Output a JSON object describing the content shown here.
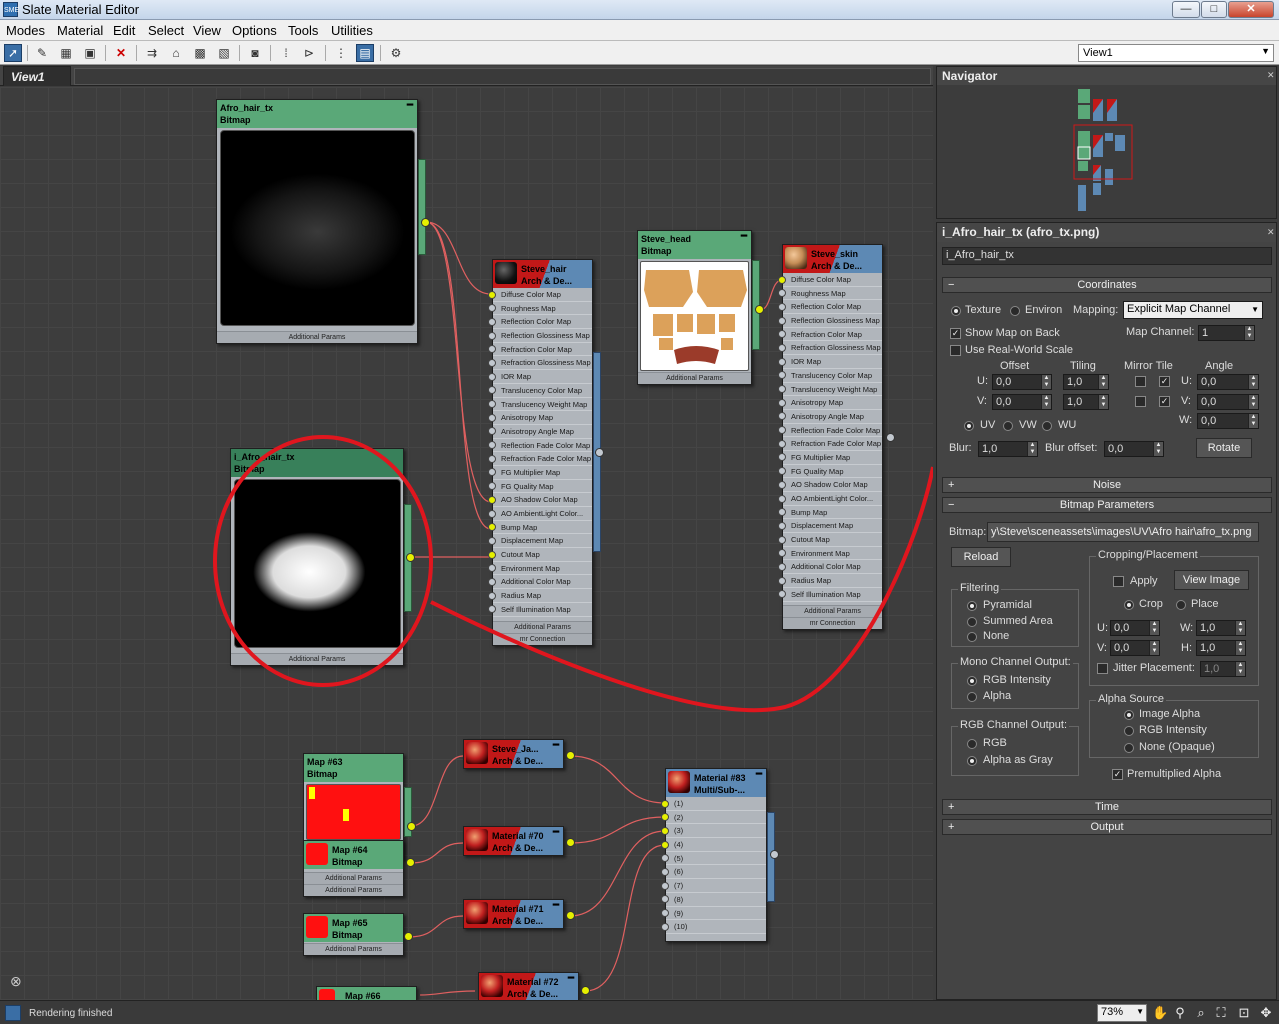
{
  "window": {
    "title": "Slate Material Editor",
    "app_icon_text": "SME",
    "buttons": [
      "—",
      "□",
      "✕"
    ]
  },
  "menu": [
    "Modes",
    "Material",
    "Edit",
    "Select",
    "View",
    "Options",
    "Tools",
    "Utilities"
  ],
  "toolbar": {
    "view_select": "View1"
  },
  "tabs": {
    "active": "View1"
  },
  "nodes": {
    "afro_hair_tx": {
      "name": "Afro_hair_tx",
      "type": "Bitmap",
      "footer": "Additional Params"
    },
    "i_afro_hair_tx": {
      "name": "i_Afro_hair_tx",
      "type": "Bitmap",
      "footer": "Additional Params"
    },
    "steve_head": {
      "name": "Steve_head",
      "type": "Bitmap",
      "footer": "Additional Params"
    },
    "steve_hair": {
      "name": "Steve_hair",
      "type": "Arch & De...",
      "footer1": "Additional Params",
      "footer2": "mr Connection",
      "slots": [
        "Diffuse Color Map",
        "Roughness Map",
        "Reflection Color Map",
        "Reflection Glossiness Map",
        "Refraction Color Map",
        "Refraction Glossiness Map",
        "IOR Map",
        "Translucency Color Map",
        "Translucency Weight Map",
        "Anisotropy Map",
        "Anisotropy Angle Map",
        "Reflection Fade Color Map",
        "Refraction Fade Color Map",
        "FG Multiplier Map",
        "FG Quality Map",
        "AO Shadow Color Map",
        "AO AmbientLight Color...",
        "Bump Map",
        "Displacement Map",
        "Cutout Map",
        "Environment Map",
        "Additional Color Map",
        "Radius Map",
        "Self Illumination Map"
      ]
    },
    "steve_skin": {
      "name": "Steve_skin",
      "type": "Arch & De...",
      "footer1": "Additional Params",
      "footer2": "mr Connection",
      "slots": [
        "Diffuse Color Map",
        "Roughness Map",
        "Reflection Color Map",
        "Reflection Glossiness Map",
        "Refraction Color Map",
        "Refraction Glossiness Map",
        "IOR Map",
        "Translucency Color Map",
        "Translucency Weight Map",
        "Anisotropy Map",
        "Anisotropy Angle Map",
        "Reflection Fade Color Map",
        "Refraction Fade Color Map",
        "FG Multiplier Map",
        "FG Quality Map",
        "AO Shadow Color Map",
        "AO AmbientLight Color...",
        "Bump Map",
        "Displacement Map",
        "Cutout Map",
        "Environment Map",
        "Additional Color Map",
        "Radius Map",
        "Self Illumination Map"
      ]
    },
    "map63": {
      "name": "Map #63",
      "type": "Bitmap",
      "footer": "Additional Params"
    },
    "map64": {
      "name": "Map #64",
      "type": "Bitmap",
      "footer": "Additional Params"
    },
    "map65": {
      "name": "Map #65",
      "type": "Bitmap",
      "footer": "Additional Params"
    },
    "map66": {
      "name": "Map #66"
    },
    "steve_ja": {
      "name": "Steve_Ja...",
      "type": "Arch & De..."
    },
    "mat70": {
      "name": "Material #70",
      "type": "Arch & De..."
    },
    "mat71": {
      "name": "Material #71",
      "type": "Arch & De..."
    },
    "mat72": {
      "name": "Material #72",
      "type": "Arch & De..."
    },
    "mat83": {
      "name": "Material #83",
      "type": "Multi/Sub-...",
      "slots": [
        "(1)",
        "(2)",
        "(3)",
        "(4)",
        "(5)",
        "(6)",
        "(7)",
        "(8)",
        "(9)",
        "(10)"
      ]
    }
  },
  "navigator": {
    "title": "Navigator"
  },
  "properties": {
    "title": "i_Afro_hair_tx (afro_tx.png)",
    "name_field": "i_Afro_hair_tx",
    "coordinates": {
      "rollout": "Coordinates",
      "texture": "Texture",
      "environ": "Environ",
      "mapping_label": "Mapping:",
      "mapping_value": "Explicit Map Channel",
      "show_map_on_back": "Show Map on Back",
      "map_channel_label": "Map Channel:",
      "map_channel_value": "1",
      "use_real_world_scale": "Use Real-World Scale",
      "offset": "Offset",
      "tiling": "Tiling",
      "mirror_tile": "Mirror Tile",
      "angle": "Angle",
      "u_label": "U:",
      "v_label": "V:",
      "w_label": "W:",
      "u_offset": "0,0",
      "v_offset": "0,0",
      "u_tiling": "1,0",
      "v_tiling": "1,0",
      "u_angle": "0,0",
      "v_angle": "0,0",
      "w_angle": "0,0",
      "uv": "UV",
      "vw": "VW",
      "wu": "WU",
      "blur_label": "Blur:",
      "blur_value": "1,0",
      "blur_offset_label": "Blur offset:",
      "blur_offset_value": "0,0",
      "rotate": "Rotate"
    },
    "noise": "Noise",
    "bitmap_params": {
      "rollout": "Bitmap Parameters",
      "bitmap_label": "Bitmap:",
      "bitmap_path": "y\\Steve\\sceneassets\\images\\UV\\Afro hair\\afro_tx.png",
      "reload": "Reload",
      "cropping_placement": "Cropping/Placement",
      "apply": "Apply",
      "view_image": "View Image",
      "crop": "Crop",
      "place": "Place",
      "u_label": "U:",
      "v_label": "V:",
      "w_label": "W:",
      "h_label": "H:",
      "crop_u": "0,0",
      "crop_v": "0,0",
      "crop_w": "1,0",
      "crop_h": "1,0",
      "jitter_placement": "Jitter Placement:",
      "jitter_value": "1,0",
      "filtering": "Filtering",
      "pyramidal": "Pyramidal",
      "summed_area": "Summed Area",
      "none": "None",
      "mono_channel_output": "Mono Channel Output:",
      "rgb_intensity": "RGB Intensity",
      "alpha": "Alpha",
      "rgb_channel_output": "RGB Channel Output:",
      "rgb": "RGB",
      "alpha_as_gray": "Alpha as Gray",
      "alpha_source": "Alpha Source",
      "image_alpha": "Image Alpha",
      "alpha_rgb_intensity": "RGB Intensity",
      "none_opaque": "None (Opaque)",
      "premultiplied_alpha": "Premultiplied Alpha"
    },
    "time": "Time",
    "output": "Output"
  },
  "status": {
    "text": "Rendering finished",
    "zoom": "73%"
  }
}
